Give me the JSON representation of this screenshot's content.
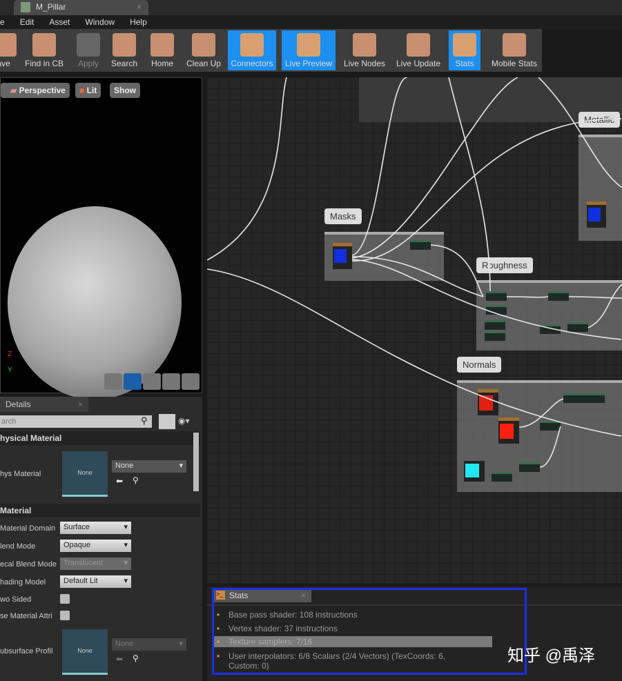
{
  "window": {
    "tab_title": "M_Pillar"
  },
  "menu": [
    "e",
    "Edit",
    "Asset",
    "Window",
    "Help"
  ],
  "toolbar": [
    {
      "label": "ave",
      "icon": "save-icon"
    },
    {
      "label": "Find in CB",
      "icon": "magnifier-icon"
    },
    {
      "label": "Apply",
      "icon": "checkmark-icon",
      "disabled": true
    },
    {
      "label": "Search",
      "icon": "binoculars-icon"
    },
    {
      "label": "Home",
      "icon": "home-icon"
    },
    {
      "label": "Clean Up",
      "icon": "broom-icon"
    },
    {
      "label": "Connectors",
      "icon": "connectors-icon",
      "active": true
    },
    {
      "label": "Live Preview",
      "icon": "tv-icon",
      "active": true
    },
    {
      "label": "Live Nodes",
      "icon": "live-nodes-icon"
    },
    {
      "label": "Live Update",
      "icon": "live-update-icon"
    },
    {
      "label": "Stats",
      "icon": "stats-icon",
      "active": true
    },
    {
      "label": "Mobile Stats",
      "icon": "mobile-stats-icon"
    }
  ],
  "viewport": {
    "perspective": "Perspective",
    "lit": "Lit",
    "show": "Show",
    "axis_z": "Z",
    "axis_y": "Y"
  },
  "details": {
    "tab": "Details",
    "search_placeholder": "arch",
    "phys_section": "hysical Material",
    "phys_label": "hys Material",
    "phys_thumb": "None",
    "phys_value": "None",
    "mat_section": "Material",
    "rows": [
      {
        "label": "Material Domain",
        "value": "Surface"
      },
      {
        "label": "lend Mode",
        "value": "Opaque"
      },
      {
        "label": "ecal Blend Mode",
        "value": "Translucent",
        "disabled": true
      },
      {
        "label": "hading Model",
        "value": "Default Lit"
      }
    ],
    "two_sided": "wo Sided",
    "use_mat_attr": "se Material Attri",
    "subsurface": "ubsurface Profil",
    "sub_thumb": "None",
    "sub_value": "None"
  },
  "graph": {
    "comments": [
      "Masks",
      "Roughness",
      "Normals",
      "Metallic"
    ]
  },
  "stats": {
    "tab": "Stats",
    "lines": [
      "Base pass shader: 108 instructions",
      "Vertex shader: 37 instructions",
      "Texture samplers: 7/16",
      "User interpolators: 6/8 Scalars (2/4 Vectors) (TexCoords: 6, Custom: 0)"
    ]
  },
  "watermark": "知乎 @禹泽",
  "colors": {
    "active": "#1c8ff0",
    "highlight_box": "#1a2ee8"
  }
}
